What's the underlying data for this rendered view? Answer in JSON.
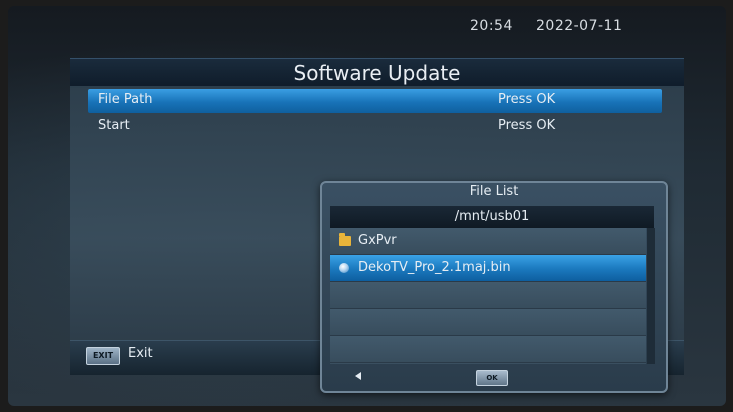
{
  "status_bar": {
    "time": "20:54",
    "date": "2022-07-11"
  },
  "header": {
    "title": "Software Update"
  },
  "menu": {
    "items": [
      {
        "label": "File Path",
        "value": "Press OK",
        "selected": true
      },
      {
        "label": "Start",
        "value": "Press OK",
        "selected": false
      }
    ]
  },
  "footer": {
    "exit_key": "EXIT",
    "exit_label": "Exit"
  },
  "dialog": {
    "title": "File List",
    "path": "/mnt/usb01",
    "files": [
      {
        "name": "GxPvr",
        "icon": "folder-icon",
        "selected": false
      },
      {
        "name": "DekoTV_Pro_2.1maj.bin",
        "icon": "file-icon",
        "selected": true
      }
    ],
    "ok_key": "OK"
  },
  "colors": {
    "highlight": "#1a78bd",
    "folder": "#e8b43a"
  }
}
